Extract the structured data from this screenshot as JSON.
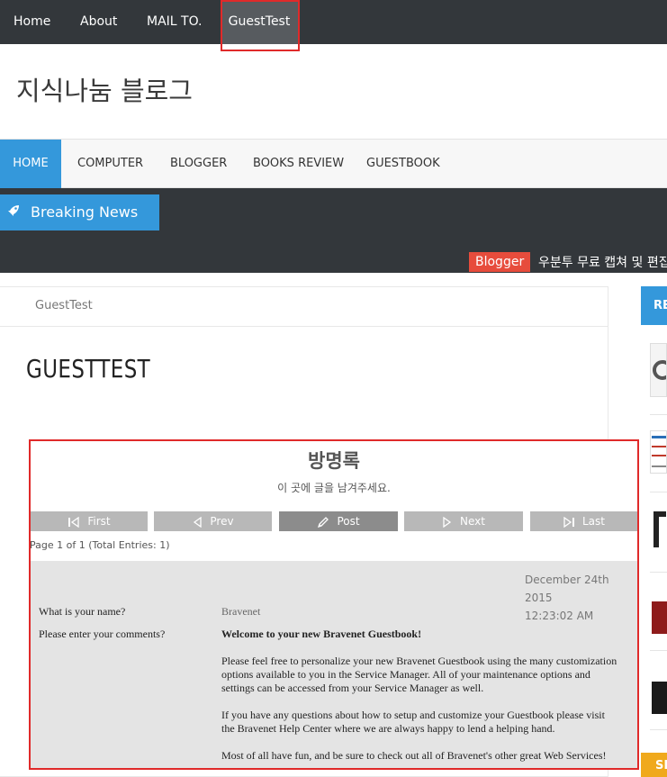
{
  "topnav": {
    "items": [
      "Home",
      "About",
      "MAIL TO.",
      "GuestTest"
    ]
  },
  "site": {
    "logo": "지식나눔 블로그"
  },
  "mainnav": {
    "items": [
      "HOME",
      "COMPUTER",
      "BLOGGER",
      "BOOKS REVIEW",
      "GUESTBOOK"
    ]
  },
  "news": {
    "label": "Breaking News",
    "tag": "Blogger",
    "ticker": "우분투 무료 캡쳐 및 편집"
  },
  "page": {
    "breadcrumb": "GuestTest",
    "title": "GUESTTEST"
  },
  "guestbook": {
    "title": "방명록",
    "subtitle": "이 곳에 글을 남겨주세요.",
    "buttons": [
      "First",
      "Prev",
      "Post",
      "Next",
      "Last"
    ],
    "page_info": "Page 1 of 1 (Total Entries: 1)",
    "entry": {
      "date": "December 24th 2015",
      "time": "12:23:02 AM",
      "name_label": "What is your name?",
      "name_value": "Bravenet",
      "comment_label": "Please enter your comments?",
      "comment_heading": "Welcome to your new Bravenet Guestbook!",
      "p1": "Please feel free to personalize your new Bravenet Guestbook using the many customization options available to you in the Service Manager. All of your maintenance options and settings can be accessed from your Service Manager as well.",
      "p2": "If you have any questions about how to setup and customize your Guestbook please visit the Bravenet Help Center where we are always happy to lend a helping hand.",
      "p3": "Most of all have fun, and be sure to check out all of Bravenet's other great Web Services!"
    }
  },
  "sidebar": {
    "tab_top": "RE",
    "tab_bottom": "SP"
  },
  "colors": {
    "dark_bar": "#33373b",
    "accent_blue": "#3498db",
    "tag_red": "#e74c3c",
    "highlight_red": "#e02a2a"
  }
}
